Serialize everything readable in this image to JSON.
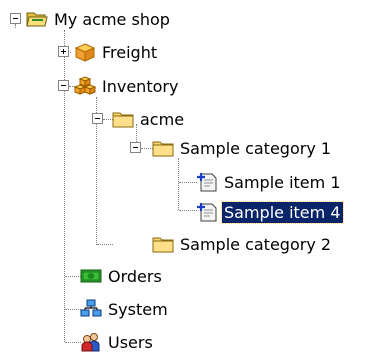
{
  "tree": {
    "root": {
      "label": "My acme shop",
      "icon": "open-folder-icon",
      "expanded": true
    },
    "freight": {
      "label": "Freight",
      "icon": "freight-box-icon",
      "expanded": false
    },
    "inventory": {
      "label": "Inventory",
      "icon": "inventory-boxes-icon",
      "expanded": true
    },
    "acme": {
      "label": "acme",
      "icon": "folder-icon",
      "expanded": true
    },
    "sample_category_1": {
      "label": "Sample category 1",
      "icon": "folder-icon",
      "expanded": true
    },
    "sample_item_1": {
      "label": "Sample item 1",
      "icon": "item-icon"
    },
    "sample_item_4": {
      "label": "Sample item 4",
      "icon": "item-icon",
      "selected": true
    },
    "sample_category_2": {
      "label": "Sample category 2",
      "icon": "folder-icon"
    },
    "orders": {
      "label": "Orders",
      "icon": "orders-money-icon"
    },
    "system": {
      "label": "System",
      "icon": "system-network-icon"
    },
    "users": {
      "label": "Users",
      "icon": "users-icon"
    }
  },
  "colors": {
    "selection": "#0a246a",
    "folder": "#f7d36b",
    "connector": "#808080"
  }
}
